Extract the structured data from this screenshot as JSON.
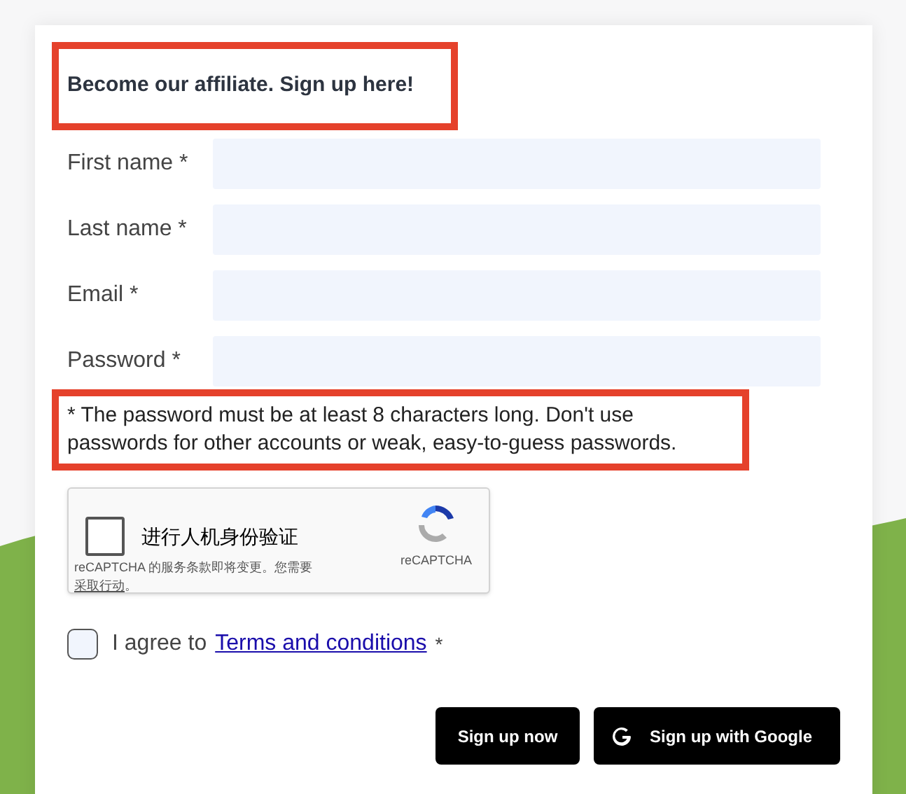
{
  "heading": "Become our affiliate. Sign up here!",
  "fields": [
    {
      "label": "First name *"
    },
    {
      "label": "Last name *"
    },
    {
      "label": "Email *"
    },
    {
      "label": "Password *"
    }
  ],
  "password_note": "* The password must be at least 8 characters long. Don't use passwords for other accounts or weak, easy-to-guess passwords.",
  "captcha": {
    "checked": false,
    "label": "进行人机身份验证",
    "notice": "reCAPTCHA 的服务条款即将变更。您需要",
    "notice_link": "采取行动",
    "notice_end": "。",
    "brand": "reCAPTCHA"
  },
  "agree": {
    "checked": false,
    "text": "I agree to",
    "link": "Terms and conditions",
    "suffix": "*"
  },
  "buttons": [
    {
      "kind": "plain",
      "label": "Sign up now"
    },
    {
      "kind": "google",
      "label": "Sign up with Google"
    }
  ]
}
